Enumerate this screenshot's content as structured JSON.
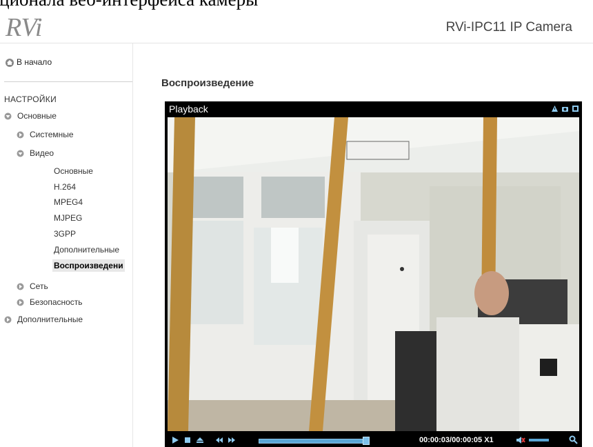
{
  "doc_caption": "кционала веб-интерфейса камеры",
  "header": {
    "logo_text": "RVi",
    "camera_title": "RVi-IPC11 IP Camera"
  },
  "sidebar": {
    "home": "В начало",
    "section": "НАСТРОЙКИ",
    "items": [
      {
        "label": "Основные",
        "level": 0,
        "expanded": true
      },
      {
        "label": "Системные",
        "level": 1,
        "expanded": false
      },
      {
        "label": "Видео",
        "level": 1,
        "expanded": true
      },
      {
        "label": "Основные",
        "level": 2
      },
      {
        "label": "H.264",
        "level": 2
      },
      {
        "label": "MPEG4",
        "level": 2
      },
      {
        "label": "MJPEG",
        "level": 2
      },
      {
        "label": "3GPP",
        "level": 2
      },
      {
        "label": "Дополнительные",
        "level": 2
      },
      {
        "label": "Воспроизведени",
        "level": 2,
        "active": true
      },
      {
        "label": "Сеть",
        "level": 1,
        "expanded": false
      },
      {
        "label": "Безопасность",
        "level": 1,
        "expanded": false
      },
      {
        "label": "Дополнительные",
        "level": 0,
        "expanded": false
      }
    ]
  },
  "main": {
    "title": "Воспроизведение",
    "player": {
      "title": "Playback",
      "time": "00:00:03/00:00:05",
      "speed": "X1",
      "progress": 0.6,
      "volume": 0.7
    }
  },
  "colors": {
    "accent": "#5aa7d6",
    "player_bg": "#000000"
  }
}
